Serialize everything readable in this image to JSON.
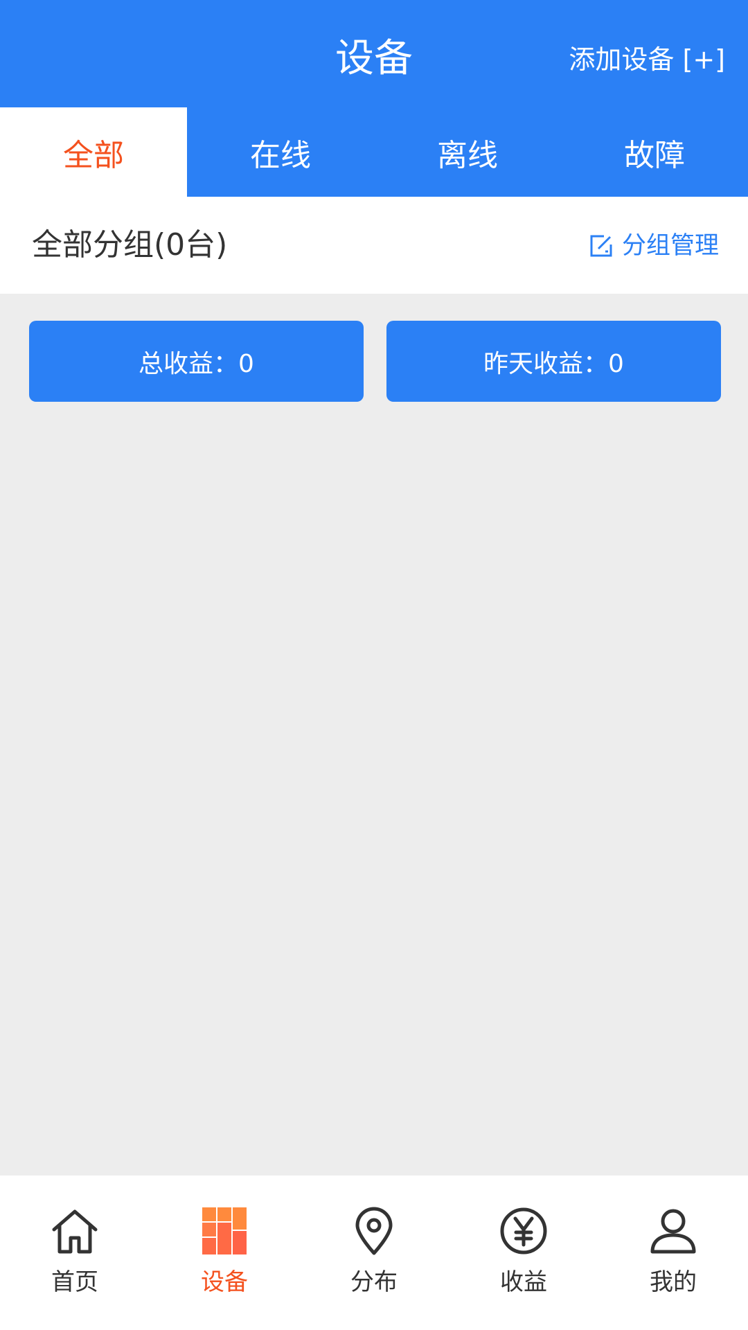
{
  "header": {
    "title": "设备",
    "add_device": "添加设备 [+]"
  },
  "tabs": [
    {
      "label": "全部",
      "active": true
    },
    {
      "label": "在线",
      "active": false
    },
    {
      "label": "离线",
      "active": false
    },
    {
      "label": "故障",
      "active": false
    }
  ],
  "group": {
    "title": "全部分组(0台)",
    "manage_label": "分组管理",
    "manage_icon": "edit-icon"
  },
  "earnings": {
    "total": "总收益：0",
    "yesterday": "昨天收益：0"
  },
  "bottom_nav": [
    {
      "label": "首页",
      "icon": "home-icon",
      "active": false
    },
    {
      "label": "设备",
      "icon": "grid-icon",
      "active": true
    },
    {
      "label": "分布",
      "icon": "location-pin-icon",
      "active": false
    },
    {
      "label": "收益",
      "icon": "yuan-icon",
      "active": false
    },
    {
      "label": "我的",
      "icon": "user-icon",
      "active": false
    }
  ],
  "colors": {
    "primary": "#2b80f5",
    "accent": "#f4511e",
    "background": "#ededed",
    "text": "#333333"
  }
}
